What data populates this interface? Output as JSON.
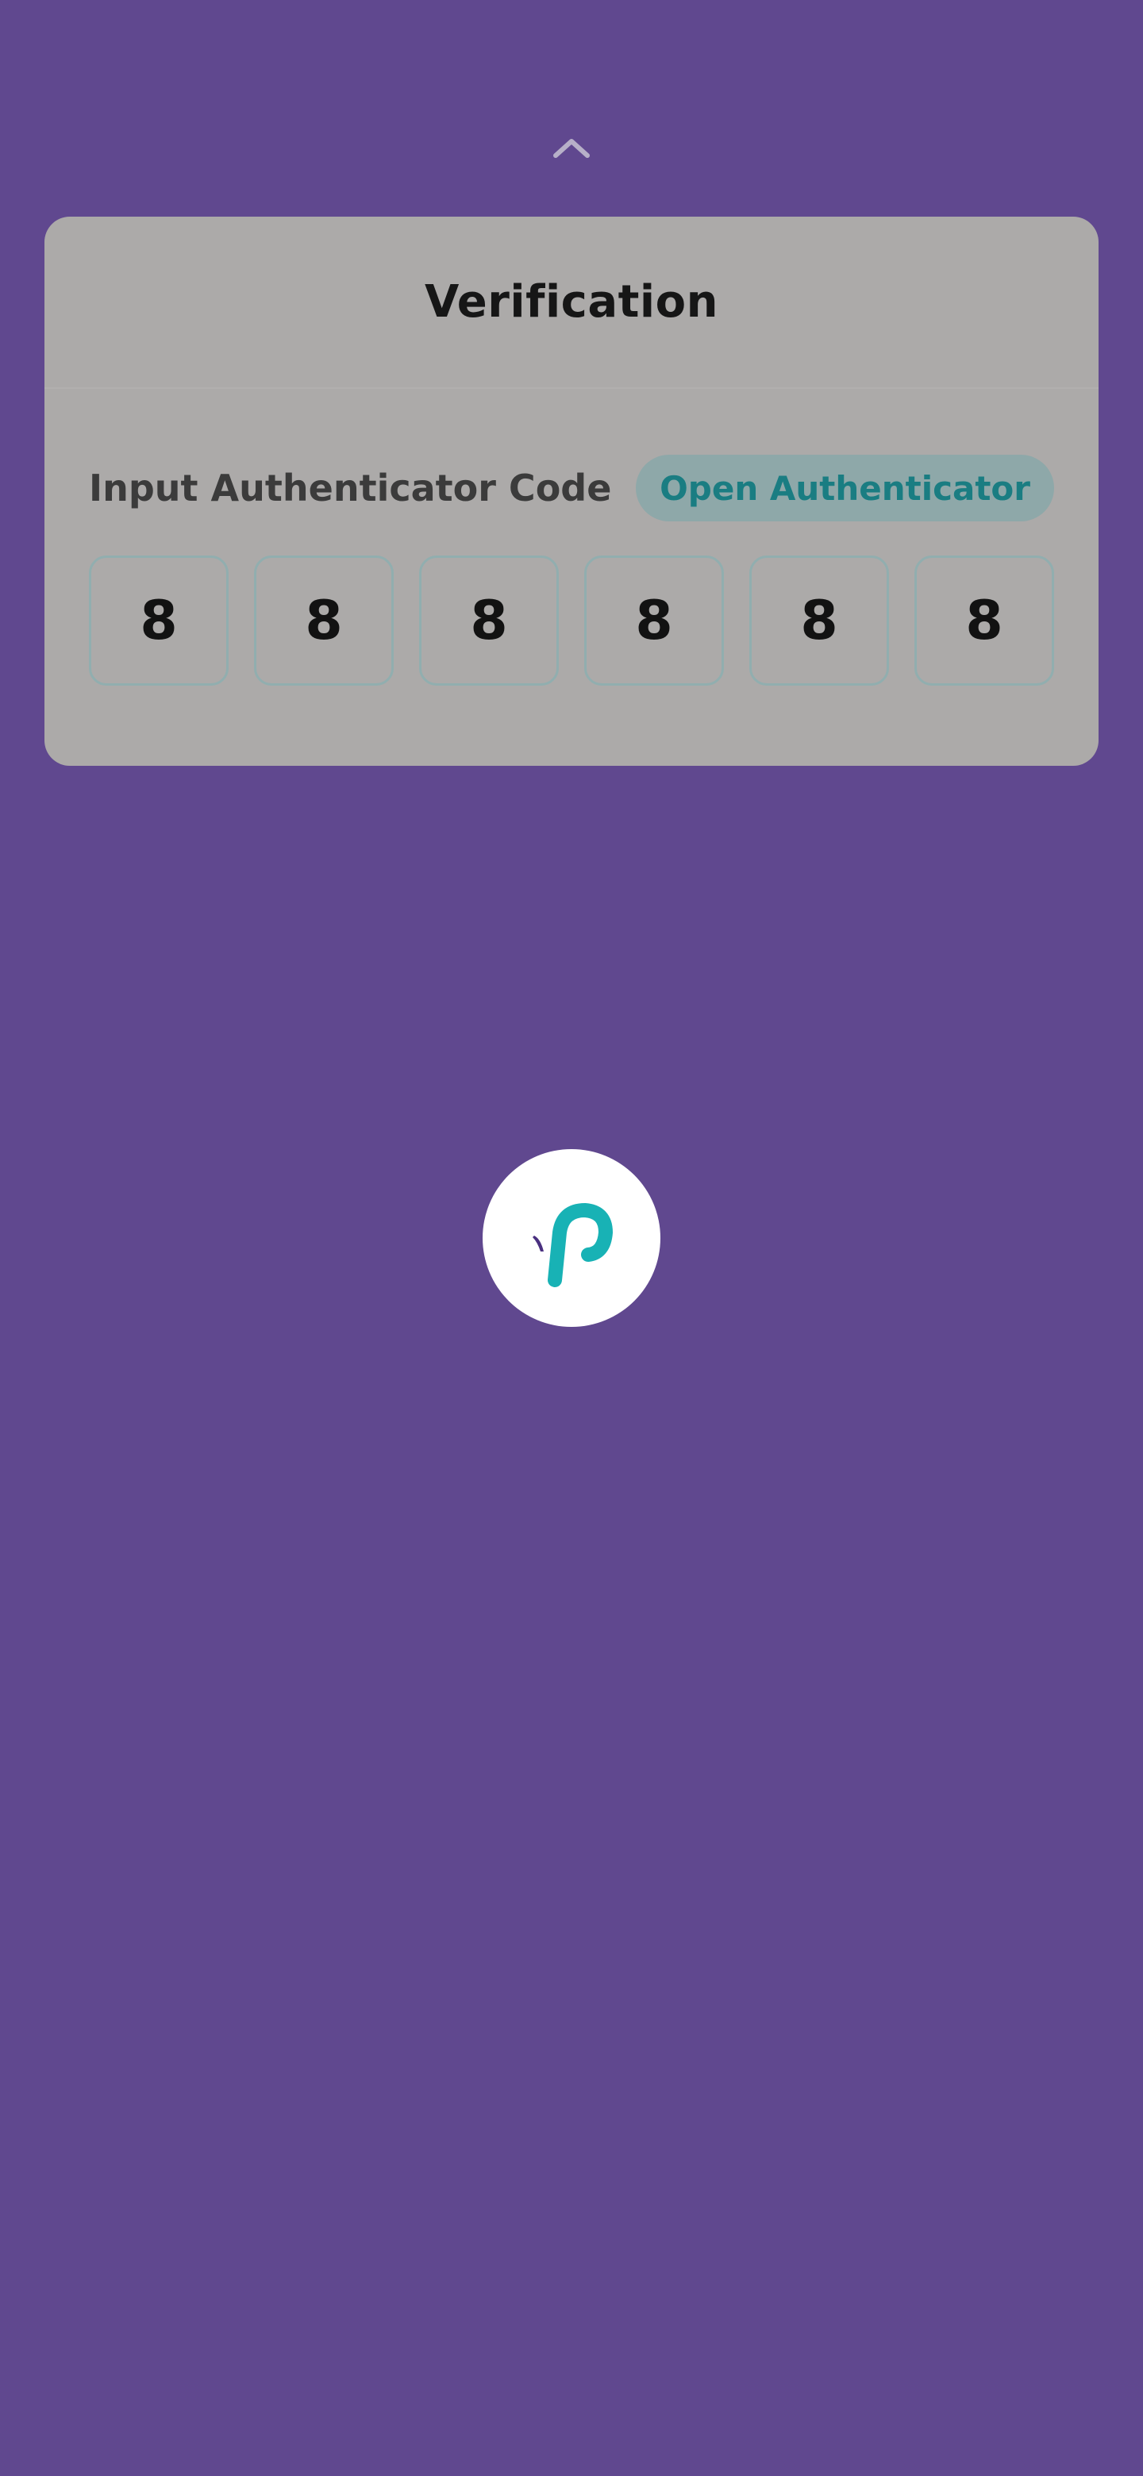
{
  "card": {
    "title": "Verification",
    "code_label": "Input Authenticator Code",
    "open_button_label": "Open Authenticator",
    "digits": [
      "8",
      "8",
      "8",
      "8",
      "8",
      "8"
    ]
  },
  "icons": {
    "collapse": "chevron-up-icon",
    "logo": "app-logo"
  },
  "colors": {
    "background": "#60488f",
    "card": "#acaaa9",
    "accent": "#1a7d82",
    "logo_teal": "#18b2b5"
  }
}
